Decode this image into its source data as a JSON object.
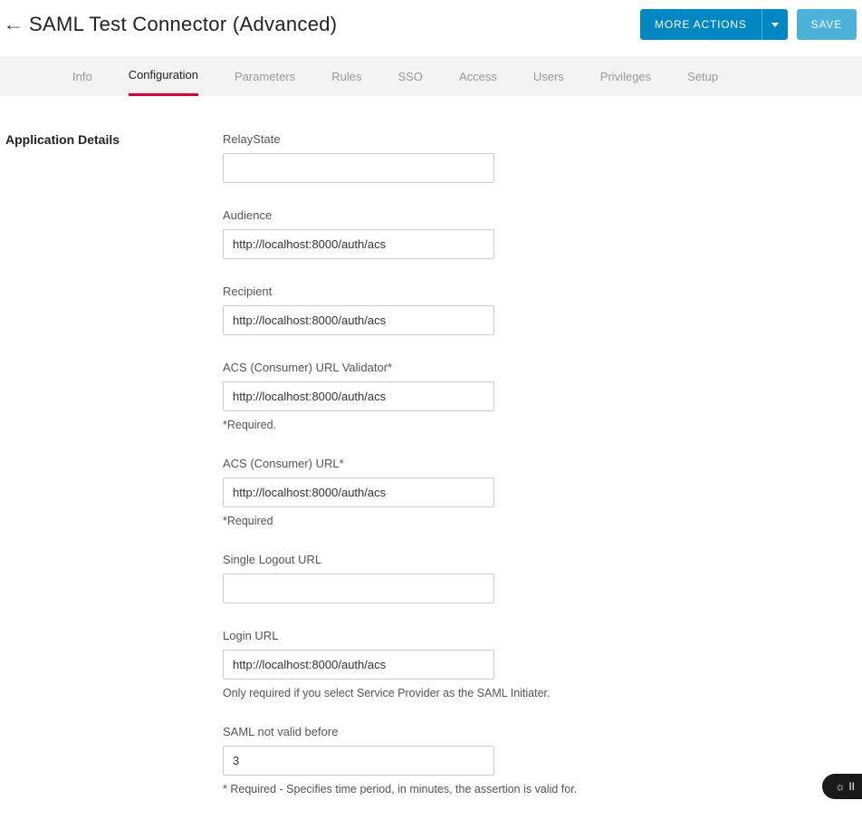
{
  "header": {
    "title": "SAML Test Connector (Advanced)",
    "more_actions": "MORE ACTIONS",
    "save": "SAVE"
  },
  "tabs": [
    {
      "label": "Info",
      "active": false
    },
    {
      "label": "Configuration",
      "active": true
    },
    {
      "label": "Parameters",
      "active": false
    },
    {
      "label": "Rules",
      "active": false
    },
    {
      "label": "SSO",
      "active": false
    },
    {
      "label": "Access",
      "active": false
    },
    {
      "label": "Users",
      "active": false
    },
    {
      "label": "Privileges",
      "active": false
    },
    {
      "label": "Setup",
      "active": false
    }
  ],
  "section_title": "Application Details",
  "fields": {
    "relaystate": {
      "label": "RelayState",
      "value": ""
    },
    "audience": {
      "label": "Audience",
      "value": "http://localhost:8000/auth/acs"
    },
    "recipient": {
      "label": "Recipient",
      "value": "http://localhost:8000/auth/acs"
    },
    "acs_validator": {
      "label": "ACS (Consumer) URL Validator*",
      "value": "http://localhost:8000/auth/acs",
      "help": "*Required."
    },
    "acs_url": {
      "label": "ACS (Consumer) URL*",
      "value": "http://localhost:8000/auth/acs",
      "help": "*Required"
    },
    "slo_url": {
      "label": "Single Logout URL",
      "value": ""
    },
    "login_url": {
      "label": "Login URL",
      "value": "http://localhost:8000/auth/acs",
      "help": "Only required if you select Service Provider as the SAML Initiater."
    },
    "not_valid_before": {
      "label": "SAML not valid before",
      "value": "3",
      "help": "* Required - Specifies time period, in minutes, the assertion is valid for."
    }
  },
  "fab": {
    "label": "II"
  }
}
